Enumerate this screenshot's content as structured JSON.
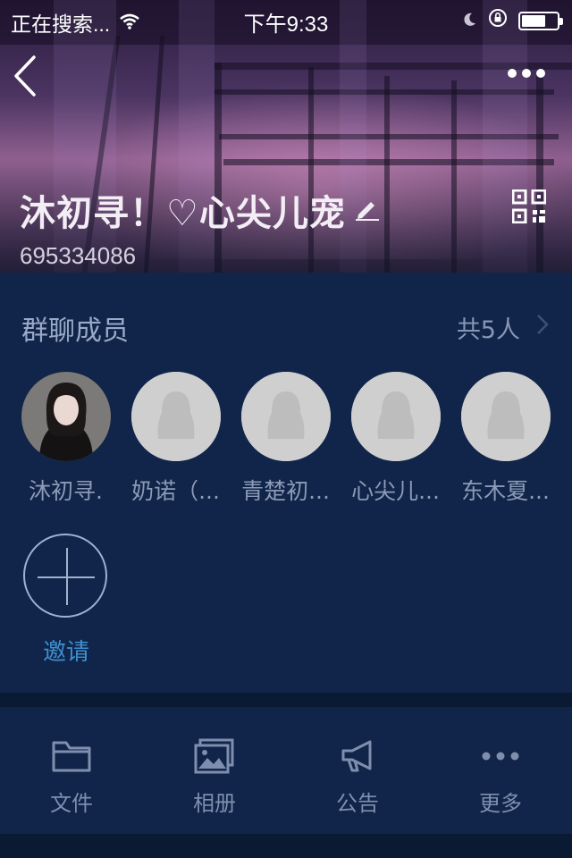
{
  "status_bar": {
    "carrier": "正在搜索...",
    "time": "下午9:33"
  },
  "header": {
    "group_name": "沐初寻！♡心尖儿宠",
    "group_id": "695334086"
  },
  "members": {
    "title": "群聊成员",
    "count": "共5人",
    "list": [
      {
        "name": "沐初寻."
      },
      {
        "name": "奶诺（..."
      },
      {
        "name": "青楚初..."
      },
      {
        "name": "心尖儿..."
      },
      {
        "name": "东木夏..."
      }
    ],
    "invite_label": "邀请"
  },
  "actions": [
    {
      "label": "文件",
      "icon": "folder-icon"
    },
    {
      "label": "相册",
      "icon": "album-icon"
    },
    {
      "label": "公告",
      "icon": "megaphone-icon"
    },
    {
      "label": "更多",
      "icon": "more-dots-icon"
    }
  ],
  "colors": {
    "background": "#102549",
    "invite_accent": "#3e8fcf",
    "muted_text": "#8c9ab7"
  }
}
